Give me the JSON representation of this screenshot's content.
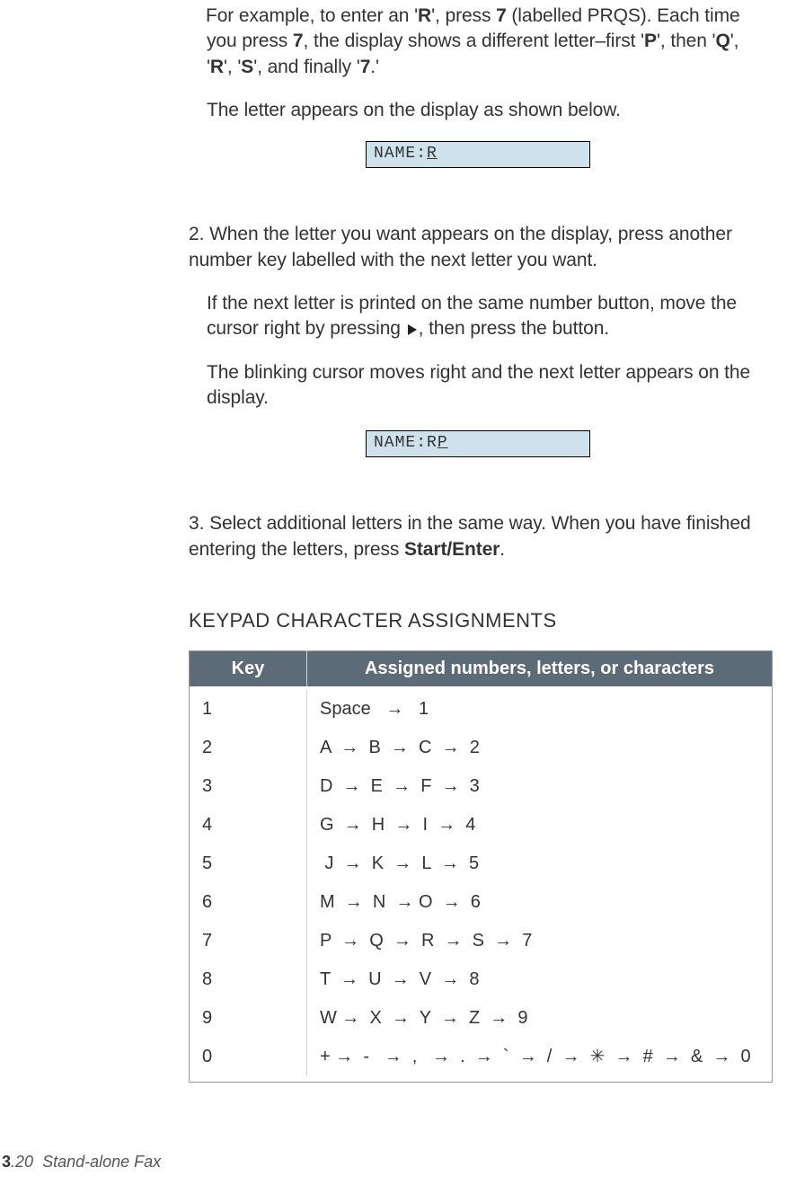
{
  "intro": {
    "p1_a": "For example, to enter an '",
    "p1_b": "', press ",
    "p1_c": " (labelled PRQS). Each time you press ",
    "p1_d": ", the display shows a different letter–first '",
    "p1_e": "', then '",
    "p1_f": "', '",
    "p1_g": "', '",
    "p1_h": "', and finally '",
    "p1_i": ".'",
    "R": "R",
    "seven": "7",
    "P": "P",
    "Q": "Q",
    "S": "S",
    "p2": "The letter appears on the display as shown below."
  },
  "display1": {
    "prefix": "NAME:",
    "cursor": "R",
    "suffix": ""
  },
  "step2": {
    "num": "2.",
    "text": "When the letter you want appears on the display, press another number key labelled with the next letter you want.",
    "p2a": "If the next letter is printed on the same number button, move the cursor right by pressing ",
    "p2b": ", then press the button.",
    "p3": "The blinking cursor moves right and the next letter appears on the display."
  },
  "display2": {
    "prefix": "NAME:R",
    "cursor": "P",
    "suffix": ""
  },
  "step3": {
    "num": "3.",
    "text_a": "Select additional letters in the same way. When you have finished entering the letters, press ",
    "text_b": ".",
    "start_enter": "Start/Enter"
  },
  "table": {
    "heading": "KEYPAD CHARACTER ASSIGNMENTS",
    "col1": "Key",
    "col2": "Assigned numbers, letters, or characters",
    "rows": [
      {
        "key": "1",
        "chars": "Space   →   1"
      },
      {
        "key": "2",
        "chars": "A  →  B  →  C  →  2"
      },
      {
        "key": "3",
        "chars": "D  →  E  →  F  →  3"
      },
      {
        "key": "4",
        "chars": "G  →  H  →  I  →  4"
      },
      {
        "key": "5",
        "chars": " J  →  K  →  L  →  5"
      },
      {
        "key": "6",
        "chars": "M  →  N  → O  →  6"
      },
      {
        "key": "7",
        "chars": "P  →  Q  →  R  →  S  →  7"
      },
      {
        "key": "8",
        "chars": "T  →  U  →  V  →  8"
      },
      {
        "key": "9",
        "chars": "W →  X  →  Y  →  Z  →  9"
      },
      {
        "key": "0",
        "chars": "+ →  -   →  ,   →  .  →  `  →  /  →  ✳  →  #  →  &  →  0"
      }
    ]
  },
  "footer": {
    "page_bold": "3",
    "page_rest": ".20",
    "title": "Stand-alone Fax"
  }
}
